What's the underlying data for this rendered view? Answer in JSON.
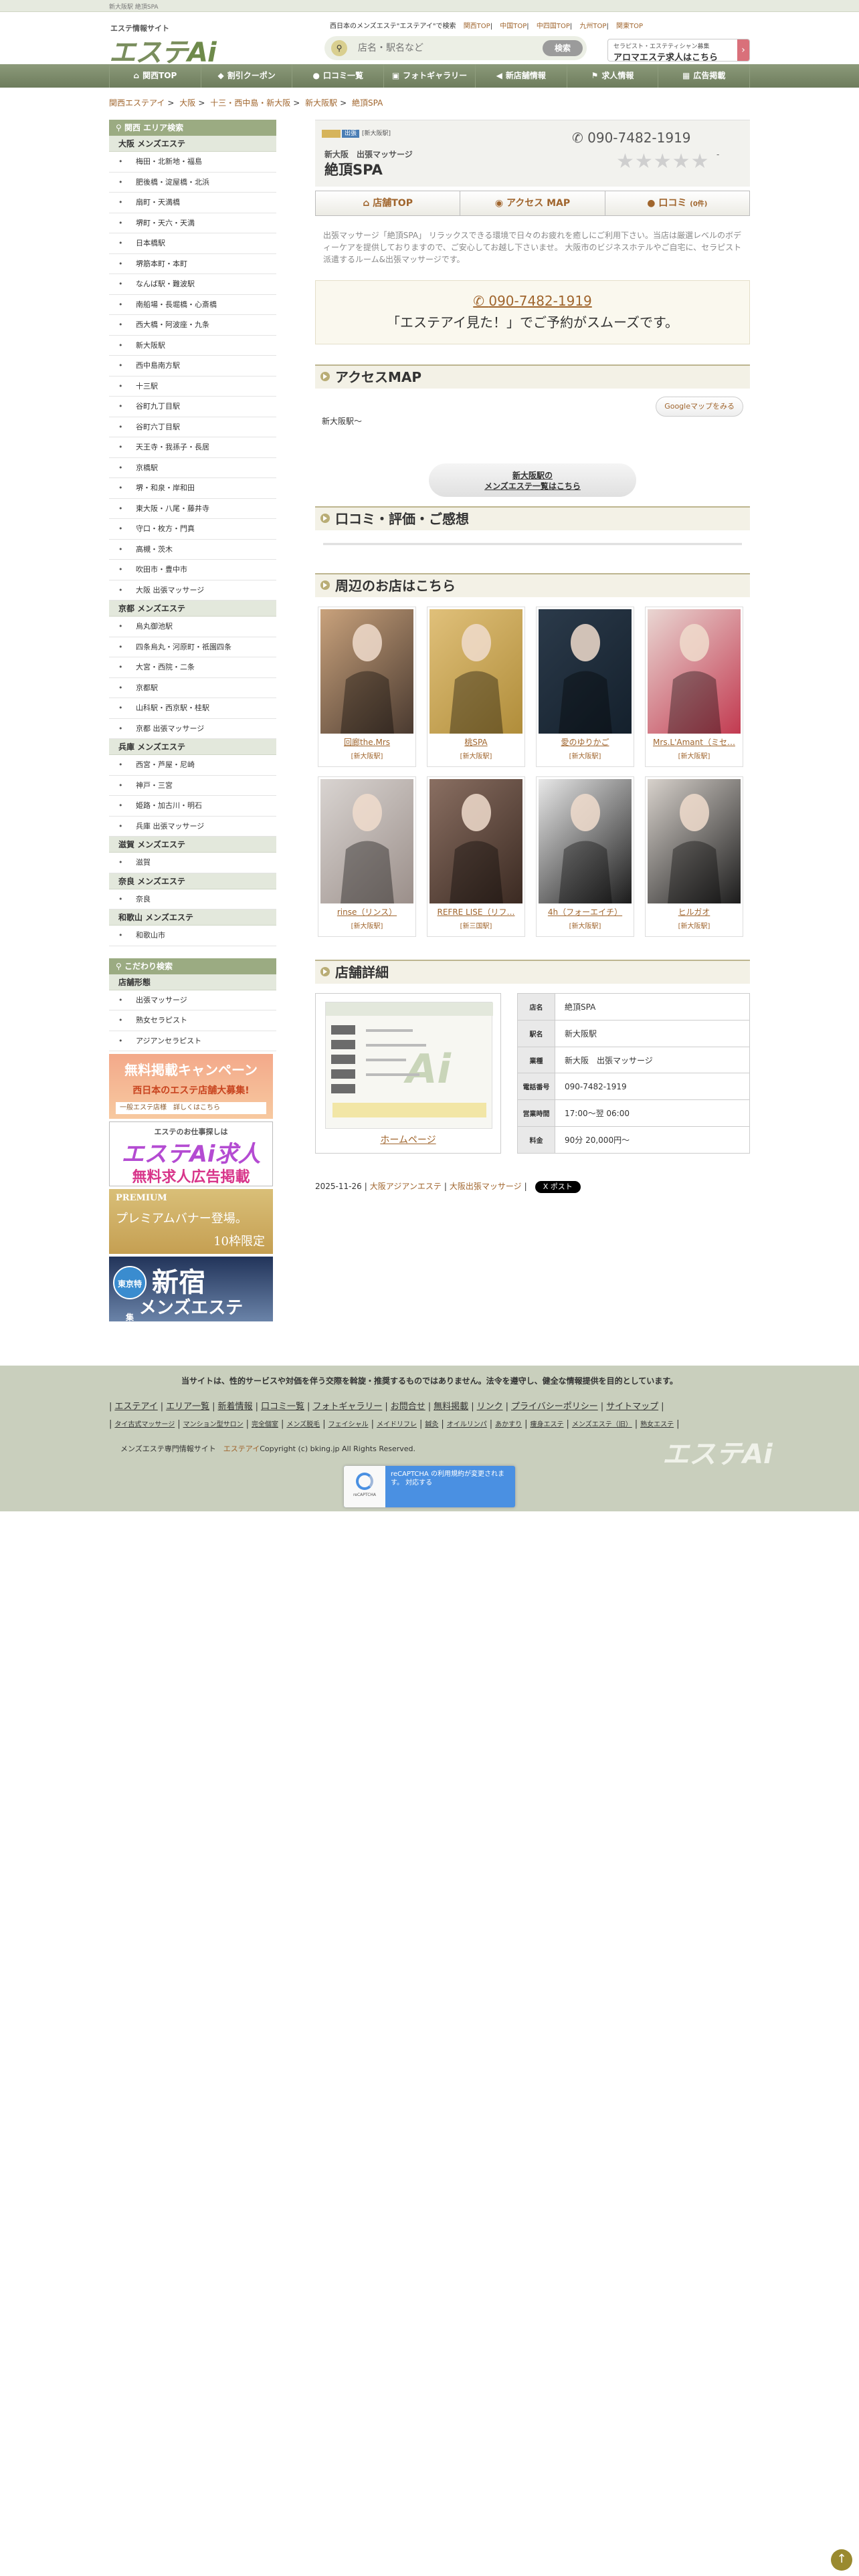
{
  "topstrip": "新大阪駅 絶頂SPA",
  "header": {
    "logo_tag": "エステ情報サイト",
    "logo_main": "エステ",
    "logo_ai": "Ai",
    "tagline": "西日本のメンズエステ\"エステアイ\"で検索",
    "links": [
      "関西TOP",
      "中国TOP",
      "中四国TOP",
      "九州TOP",
      "関東TOP"
    ],
    "search_placeholder": "店名・駅名など",
    "search_button": "検索",
    "recruit_small": "セラピスト・エステティシャン募集",
    "recruit_main": "アロマエステ求人はこちら"
  },
  "nav": [
    {
      "icon": "home-icon",
      "glyph": "⌂",
      "label": "関西TOP"
    },
    {
      "icon": "tag-icon",
      "glyph": "◆",
      "label": "割引クーポン"
    },
    {
      "icon": "comment-icon",
      "glyph": "●",
      "label": "口コミ一覧"
    },
    {
      "icon": "image-icon",
      "glyph": "▣",
      "label": "フォトギャラリー"
    },
    {
      "icon": "megaphone-icon",
      "glyph": "◀",
      "label": "新店舗情報"
    },
    {
      "icon": "flag-icon",
      "glyph": "⚑",
      "label": "求人情報"
    },
    {
      "icon": "building-icon",
      "glyph": "▦",
      "label": "広告掲載"
    }
  ],
  "breadcrumb": [
    "関西エステアイ",
    "大阪",
    "十三・西中島・新大阪",
    "新大阪駅",
    "絶頂SPA"
  ],
  "sidebar": {
    "area_header": "関西 エリア検索",
    "groups": [
      {
        "title": "大阪 メンズエステ",
        "items": [
          "梅田・北新地・福島",
          "肥後橋・淀屋橋・北浜",
          "扇町・天満橋",
          "堺町・天六・天満",
          "日本橋駅",
          "堺筋本町・本町",
          "なんば駅・難波駅",
          "南船場・長堀橋・心斎橋",
          "西大橋・阿波座・九条",
          "新大阪駅",
          "西中島南方駅",
          "十三駅",
          "谷町九丁目駅",
          "谷町六丁目駅",
          "天王寺・我孫子・長居",
          "京橋駅",
          "堺・和泉・岸和田",
          "東大阪・八尾・藤井寺",
          "守口・枚方・門真",
          "高槻・茨木",
          "吹田市・豊中市",
          "大阪 出張マッサージ"
        ]
      },
      {
        "title": "京都 メンズエステ",
        "items": [
          "烏丸御池駅",
          "四条烏丸・河原町・祇園四条",
          "大宮・西院・二条",
          "京都駅",
          "山科駅・西京駅・桂駅",
          "京都 出張マッサージ"
        ]
      },
      {
        "title": "兵庫 メンズエステ",
        "items": [
          "西宮・芦屋・尼崎",
          "神戸・三宮",
          "姫路・加古川・明石",
          "兵庫 出張マッサージ"
        ]
      },
      {
        "title": "滋賀 メンズエステ",
        "items": [
          "滋賀"
        ]
      },
      {
        "title": "奈良 メンズエステ",
        "items": [
          "奈良"
        ]
      },
      {
        "title": "和歌山 メンズエステ",
        "items": [
          "和歌山市"
        ]
      }
    ],
    "kodawari_header": "こだわり検索",
    "kodawari_sub": "店舗形態",
    "kodawari_items": [
      "出張マッサージ",
      "熟女セラピスト",
      "アジアンセラピスト"
    ],
    "banners": {
      "b1_t1": "無料掲載キャンペーン",
      "b1_t2": "西日本のエステ店舗大募集!",
      "b1_t3": "一般エステ店様　詳しくはこちら",
      "b2_t1": "エステのお仕事探しは",
      "b2_t2": "エステAi求人",
      "b2_t3": "無料求人広告掲載",
      "b3_t1": "PREMIUM",
      "b3_t2": "プレミアムバナー登場。",
      "b3_t3": "10枠限定",
      "b4_seal": "東京特集",
      "b4_t2": "新宿",
      "b4_t3": "メンズエステ"
    }
  },
  "shop": {
    "tags": [
      "",
      "出張",
      "[新大阪駅]"
    ],
    "category": "新大阪　出張マッサージ",
    "name": "絶頂SPA",
    "tel": "090-7482-1919",
    "stars": "★★★★★",
    "rating_dash": "-",
    "tabs": [
      {
        "icon": "home-icon",
        "label": "店舗TOP",
        "small": ""
      },
      {
        "icon": "map-pin-icon",
        "label": "アクセス MAP",
        "small": ""
      },
      {
        "icon": "comment-icon",
        "label": "口コミ",
        "small": "(0件)"
      }
    ],
    "description": "出張マッサージ「絶頂SPA」 リラックスできる環境で日々のお疲れを癒しにご利用下さい。当店は厳選レベルのボディーケアを提供しておりますので、ご安心してお越し下さいませ。 大阪市のビジネスホテルやご自宅に、セラピスト派遣するルーム&出張マッサージです。",
    "call_tel": "090-7482-1919",
    "call_msg": "「エステアイ見た！」でご予約がスムーズです。"
  },
  "access": {
    "title": "アクセスMAP",
    "gmap_button": "Googleマップをみる",
    "station": "新大阪駅〜",
    "station_button_l1": "新大阪駅の",
    "station_button_l2": "メンズエステ一覧はこちら"
  },
  "review": {
    "title": "口コミ・評価・ご感想"
  },
  "nearby": {
    "title": "周辺のお店はこちら",
    "shops": [
      {
        "name": "回廊the.Mrs",
        "area": "[新大阪駅]",
        "colors": [
          "#c9a27c",
          "#4a3a30"
        ]
      },
      {
        "name": "桃SPA",
        "area": "[新大阪駅]",
        "colors": [
          "#e0c07a",
          "#b08d3a"
        ]
      },
      {
        "name": "愛のゆりかご",
        "area": "[新大阪駅]",
        "colors": [
          "#2b3a4a",
          "#14202c"
        ]
      },
      {
        "name": "Mrs.L'Amant（ミセ…",
        "area": "[新大阪駅]",
        "colors": [
          "#e9d6d2",
          "#c23a50"
        ]
      },
      {
        "name": "rinse（リンス）",
        "area": "[新大阪駅]",
        "colors": [
          "#d9d4d1",
          "#9b8f8a"
        ]
      },
      {
        "name": "REFRE LISE（リフ…",
        "area": "[新三国駅]",
        "colors": [
          "#8a6f62",
          "#3b2a22"
        ]
      },
      {
        "name": "4h（フォーエイチ）",
        "area": "[新大阪駅]",
        "colors": [
          "#e8e8e8",
          "#1b1b1b"
        ]
      },
      {
        "name": "ヒルガオ",
        "area": "[新大阪駅]",
        "colors": [
          "#d8d2cc",
          "#1c1c1c"
        ]
      }
    ]
  },
  "detail": {
    "title": "店舗詳細",
    "homepage_link": "ホームページ",
    "rows": [
      {
        "k": "店名",
        "v": "絶頂SPA"
      },
      {
        "k": "駅名",
        "v": "新大阪駅"
      },
      {
        "k": "業種",
        "v": "新大阪　出張マッサージ"
      },
      {
        "k": "電話番号",
        "v": "090-7482-1919"
      },
      {
        "k": "営業時間",
        "v": "17:00〜翌 06:00"
      },
      {
        "k": "料金",
        "v": "90分 20,000円〜"
      }
    ]
  },
  "share": {
    "date": "2025-11-26",
    "link1": "大阪アジアンエステ",
    "link2": "大阪出張マッサージ",
    "x_label": "X ポスト"
  },
  "footer": {
    "notice": "当サイトは、性的サービスや対価を伴う交際を斡旋・推奨するものではありません。法令を遵守し、健全な情報提供を目的としています。",
    "links_row1": [
      "エステアイ",
      "エリア一覧",
      "新着情報",
      "口コミ一覧",
      "フォトギャラリー",
      "お問合せ",
      "無料掲載",
      "リンク",
      "プライバシーポリシー",
      "サイトマップ"
    ],
    "links_row2": [
      "タイ古式マッサージ",
      "マンション型サロン",
      "完全個室",
      "メンズ脱毛",
      "フェイシャル",
      "メイドリフレ",
      "鍼灸",
      "オイルリンパ",
      "あかすり",
      "痩身エステ",
      "メンズエステ（旧）",
      "熟女エステ"
    ],
    "copy_prefix": "メンズエステ専門情報サイト",
    "copy_link": "エステアイ",
    "copy_suffix": "Copyright (c) bking.jp All Rights Reserved.",
    "recaptcha_text": "reCAPTCHA の利用規約が変更されます。 対応する",
    "recaptcha_brand": "reCAPTCHA"
  }
}
